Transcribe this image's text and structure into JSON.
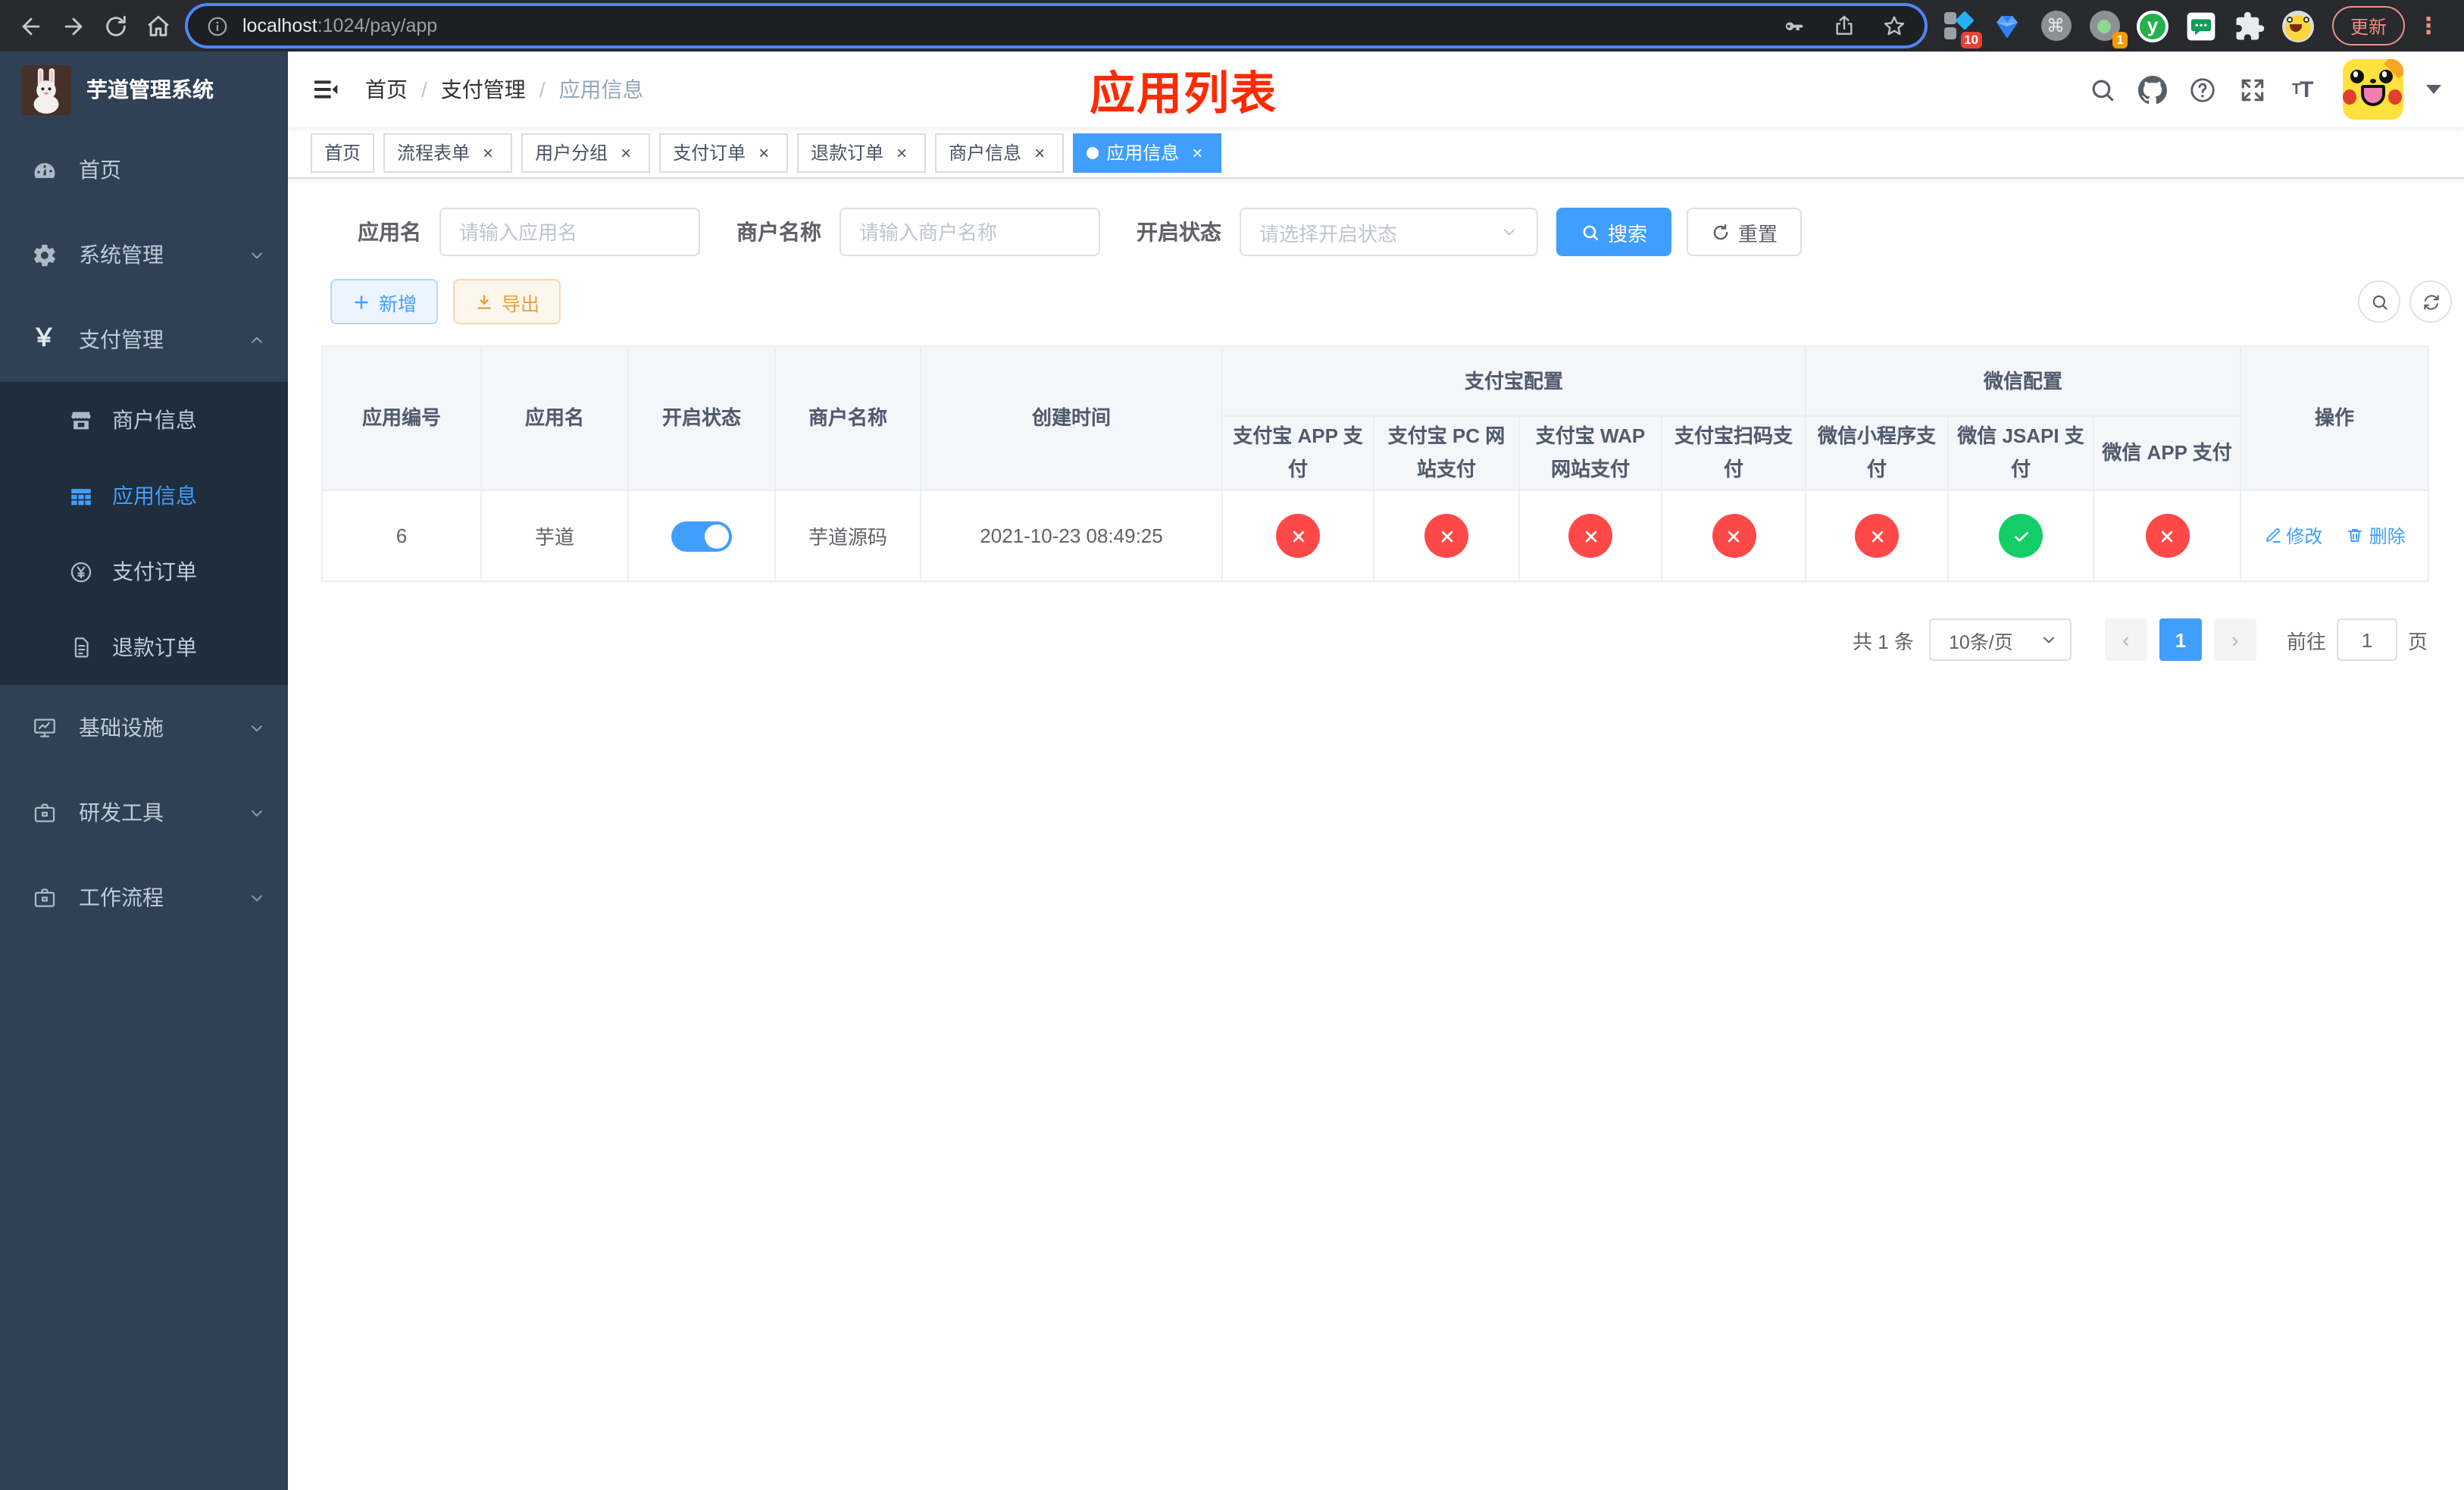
{
  "colors": {
    "primary": "#409eff",
    "success": "#13ce66",
    "danger": "#ff4949",
    "warning": "#e6a23c",
    "sidebar_bg": "#304156",
    "submenu_bg": "#1f2d3d",
    "annotation": "#ff2a00"
  },
  "browser": {
    "url_host": "localhost",
    "url_path": ":1024/pay/app",
    "update_label": "更新",
    "extensions": [
      {
        "id": "apps-grid",
        "badge": "10"
      },
      {
        "id": "gem",
        "badge": ""
      },
      {
        "id": "command",
        "badge": ""
      },
      {
        "id": "status-dot",
        "badge": "1"
      },
      {
        "id": "yudao",
        "badge": ""
      },
      {
        "id": "chat",
        "badge": ""
      },
      {
        "id": "puzzle",
        "badge": ""
      },
      {
        "id": "profile-emoji",
        "badge": ""
      }
    ]
  },
  "sidebar": {
    "title": "芋道管理系统",
    "menu": [
      {
        "id": "home",
        "icon": "dashboard-icon",
        "label": "首页",
        "type": "top",
        "chevron": "",
        "active": false,
        "expanded": false
      },
      {
        "id": "system",
        "icon": "gear-icon",
        "label": "系统管理",
        "type": "top",
        "chevron": "down",
        "active": false,
        "expanded": false
      },
      {
        "id": "payment",
        "icon": "yen-icon",
        "label": "支付管理",
        "type": "top",
        "chevron": "up",
        "active": false,
        "expanded": true
      },
      {
        "id": "merchant-info",
        "icon": "shop-icon",
        "label": "商户信息",
        "type": "sub",
        "chevron": "",
        "active": false,
        "expanded": false
      },
      {
        "id": "app-info",
        "icon": "grid-icon",
        "label": "应用信息",
        "type": "sub",
        "chevron": "",
        "active": true,
        "expanded": false
      },
      {
        "id": "pay-order",
        "icon": "yen-circle-icon",
        "label": "支付订单",
        "type": "sub",
        "chevron": "",
        "active": false,
        "expanded": false
      },
      {
        "id": "refund-order",
        "icon": "document-icon",
        "label": "退款订单",
        "type": "sub",
        "chevron": "",
        "active": false,
        "expanded": false
      },
      {
        "id": "infrastructure",
        "icon": "monitor-icon",
        "label": "基础设施",
        "type": "top",
        "chevron": "down",
        "active": false,
        "expanded": false
      },
      {
        "id": "dev-tools",
        "icon": "briefcase-icon",
        "label": "研发工具",
        "type": "top",
        "chevron": "down",
        "active": false,
        "expanded": false
      },
      {
        "id": "workflow",
        "icon": "briefcase-icon",
        "label": "工作流程",
        "type": "top",
        "chevron": "down",
        "active": false,
        "expanded": false
      }
    ]
  },
  "navbar": {
    "breadcrumb": [
      "首页",
      "支付管理",
      "应用信息"
    ],
    "annotation": "应用列表"
  },
  "tabs": [
    {
      "id": "home",
      "label": "首页",
      "closable": false,
      "active": false
    },
    {
      "id": "process-form",
      "label": "流程表单",
      "closable": true,
      "active": false
    },
    {
      "id": "user-group",
      "label": "用户分组",
      "closable": true,
      "active": false
    },
    {
      "id": "pay-order",
      "label": "支付订单",
      "closable": true,
      "active": false
    },
    {
      "id": "refund-order",
      "label": "退款订单",
      "closable": true,
      "active": false
    },
    {
      "id": "merchant-info",
      "label": "商户信息",
      "closable": true,
      "active": false
    },
    {
      "id": "app-info",
      "label": "应用信息",
      "closable": true,
      "active": true
    }
  ],
  "filters": {
    "app_name_label": "应用名",
    "app_name_placeholder": "请输入应用名",
    "merchant_label": "商户名称",
    "merchant_placeholder": "请输入商户名称",
    "status_label": "开启状态",
    "status_placeholder": "请选择开启状态",
    "search_label": "搜索",
    "reset_label": "重置"
  },
  "toolbar": {
    "add_label": "新增",
    "export_label": "导出"
  },
  "table": {
    "group_alipay": "支付宝配置",
    "group_wechat": "微信配置",
    "columns": [
      "应用编号",
      "应用名",
      "开启状态",
      "商户名称",
      "创建时间",
      "支付宝 APP 支付",
      "支付宝 PC 网站支付",
      "支付宝 WAP 网站支付",
      "支付宝扫码支付",
      "微信小程序支付",
      "微信 JSAPI 支付",
      "微信 APP 支付",
      "操作"
    ],
    "row": {
      "id": "6",
      "name": "芋道",
      "enabled": true,
      "merchant": "芋道源码",
      "created_at": "2021-10-23 08:49:25",
      "configs": [
        false,
        false,
        false,
        false,
        false,
        true,
        false
      ],
      "edit_label": "修改",
      "delete_label": "删除"
    }
  },
  "pagination": {
    "total": "共 1 条",
    "page_size": "10条/页",
    "page": "1",
    "goto": "前往",
    "goto_value": "1",
    "unit": "页"
  }
}
